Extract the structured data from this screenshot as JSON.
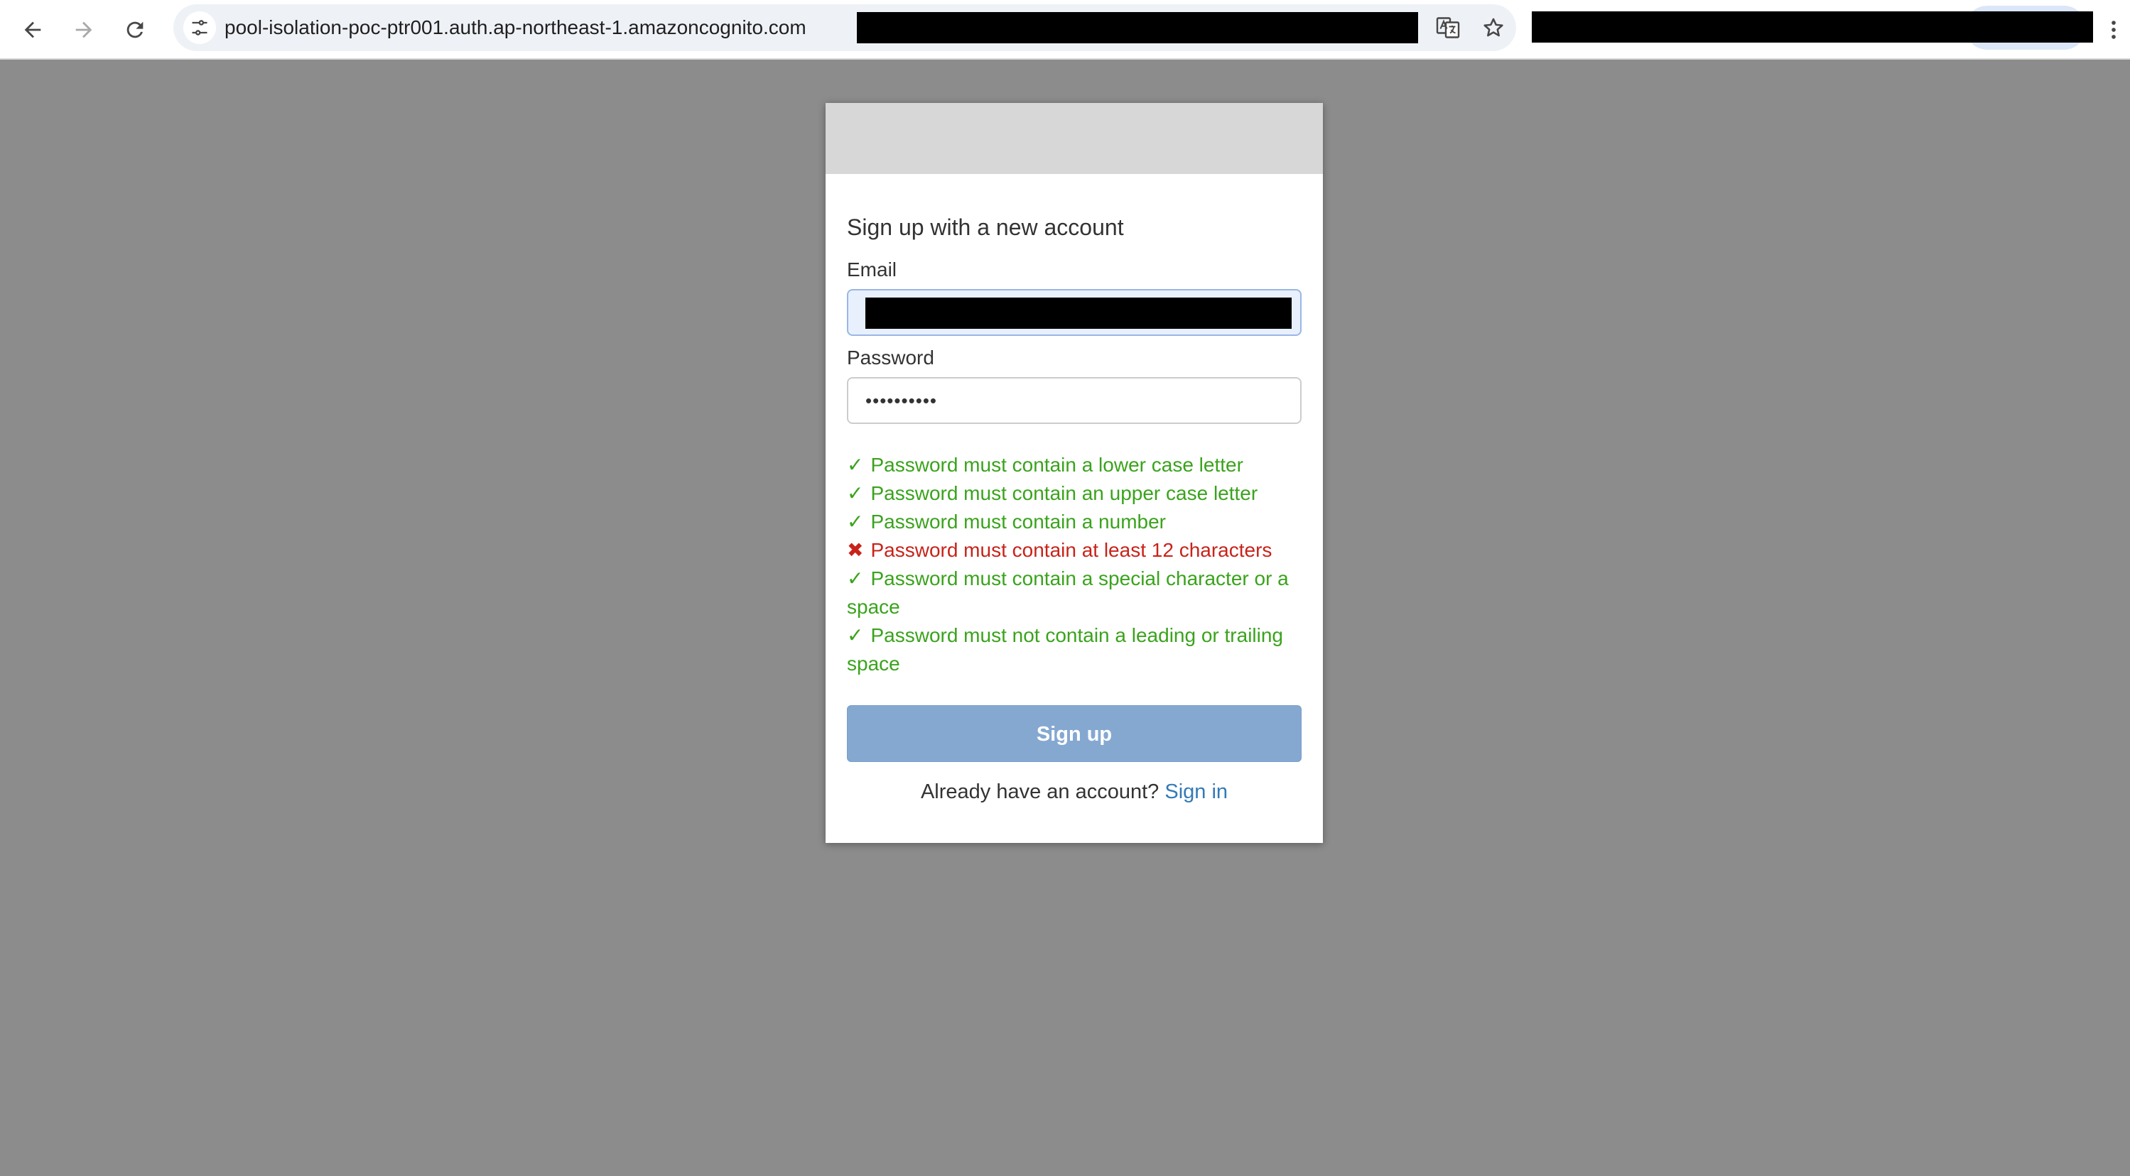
{
  "browser": {
    "url": "pool-isolation-poc-ptr001.auth.ap-northeast-1.amazoncognito.com",
    "icons": {
      "back": "arrow-left-icon",
      "forward": "arrow-right-icon",
      "reload": "reload-icon",
      "site_info": "tune-icon",
      "translate": "translate-icon",
      "bookmark": "star-icon",
      "menu": "three-dots-vertical-icon"
    }
  },
  "form": {
    "title": "Sign up with a new account",
    "email_label": "Email",
    "password_label": "Password",
    "password_value": "••••••••••",
    "requirements": [
      {
        "status": "ok",
        "icon": "✓",
        "text": "Password must contain a lower case letter"
      },
      {
        "status": "ok",
        "icon": "✓",
        "text": "Password must contain an upper case letter"
      },
      {
        "status": "ok",
        "icon": "✓",
        "text": "Password must contain a number"
      },
      {
        "status": "fail",
        "icon": "✖",
        "text": "Password must contain at least 12 characters"
      },
      {
        "status": "ok",
        "icon": "✓",
        "text": "Password must contain a special character or a space"
      },
      {
        "status": "ok",
        "icon": "✓",
        "text": "Password must not contain a leading or trailing space"
      }
    ],
    "signup_button": "Sign up",
    "signin_prompt": "Already have an account?",
    "signin_link": "Sign in"
  },
  "colors": {
    "page_background": "#8c8c8c",
    "requirement_ok": "#3aa31c",
    "requirement_fail": "#c8231a",
    "signup_button": "#85a8d1",
    "link": "#337ab7"
  }
}
